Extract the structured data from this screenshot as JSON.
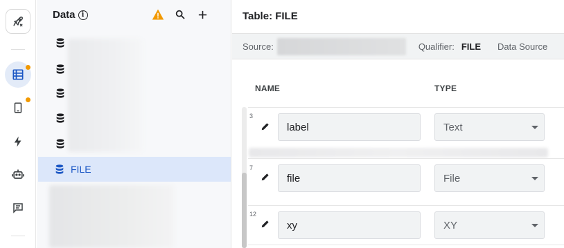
{
  "rail": {
    "items": [
      {
        "name": "launch-icon",
        "badge": false
      },
      {
        "name": "data-icon",
        "badge": true,
        "active": true
      },
      {
        "name": "phone-icon",
        "badge": true
      },
      {
        "name": "lightning-icon",
        "badge": false
      },
      {
        "name": "robot-icon",
        "badge": false
      },
      {
        "name": "chat-icon",
        "badge": false
      }
    ],
    "badge_color": "#f29900",
    "active_color": "#1a56c4"
  },
  "sidebar": {
    "title": "Data",
    "info_glyph": "i",
    "tools": [
      "warning-icon",
      "search-icon",
      "add-icon"
    ],
    "items": [
      {
        "icon": "database-icon",
        "label": ""
      },
      {
        "icon": "database-icon",
        "label": ""
      },
      {
        "icon": "database-icon",
        "label": ""
      },
      {
        "icon": "database-icon",
        "label": ""
      },
      {
        "icon": "database-icon",
        "label": ""
      }
    ],
    "selected_item": {
      "icon": "database-icon",
      "label": "FILE"
    }
  },
  "main": {
    "title": "Table: FILE",
    "info_bar": {
      "source_label": "Source:",
      "qualifier_label": "Qualifier:",
      "qualifier_value": "FILE",
      "data_source_label": "Data Source"
    },
    "columns": {
      "name": "NAME",
      "type": "TYPE"
    },
    "rows": [
      {
        "number": "3",
        "name": "label",
        "type": "Text"
      },
      {
        "number": "7",
        "name": "file",
        "type": "File"
      },
      {
        "number": "12",
        "name": "xy",
        "type": "XY"
      }
    ]
  }
}
